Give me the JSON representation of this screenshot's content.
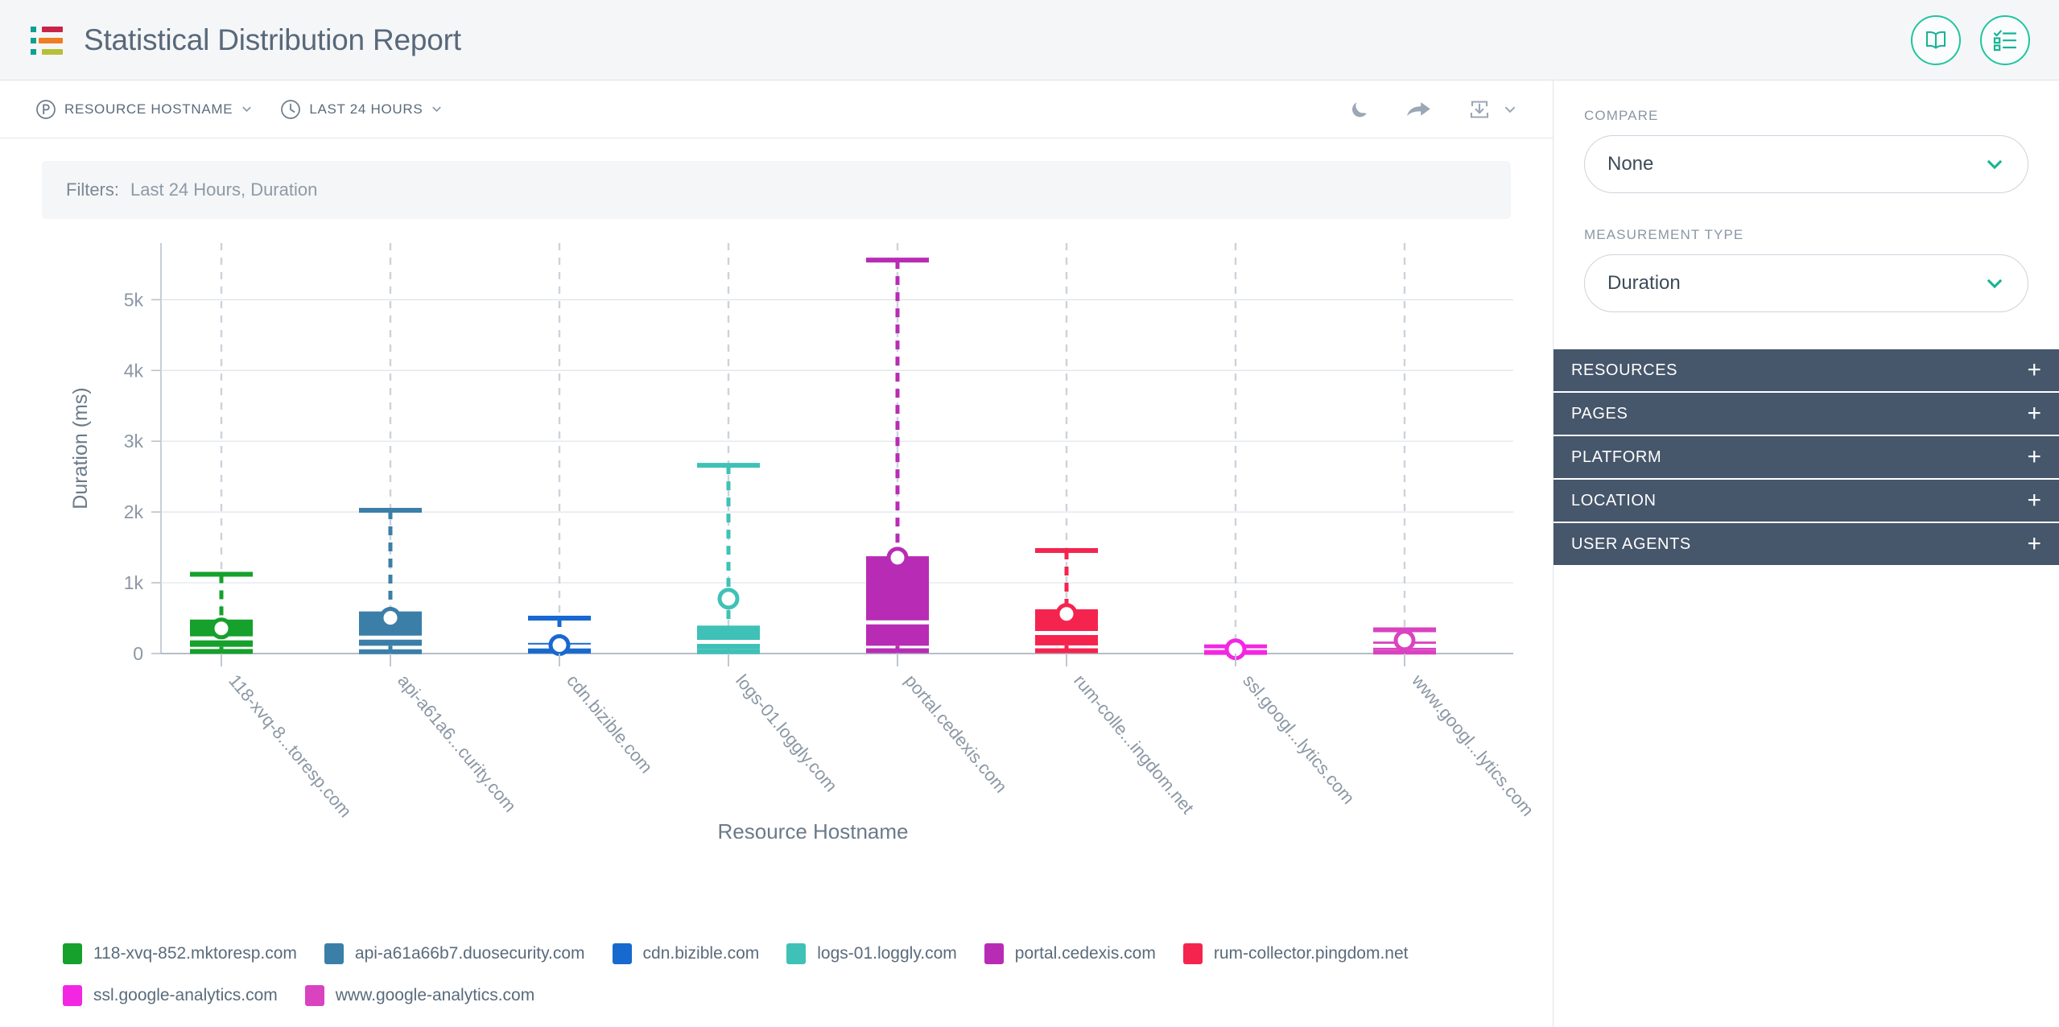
{
  "header": {
    "title": "Statistical Distribution Report",
    "logo_icon": "soasta-mpulse-logo",
    "actions": [
      {
        "name": "book-icon",
        "label": "Documentation"
      },
      {
        "name": "checklist-icon",
        "label": "Tasks"
      }
    ]
  },
  "toolbar": {
    "dimension_selector": {
      "label": "RESOURCE HOSTNAME",
      "icon": "p-circle-icon"
    },
    "time_selector": {
      "label": "LAST 24 HOURS",
      "icon": "clock-icon"
    },
    "right_actions": [
      {
        "name": "moon-icon",
        "label": "Dark Mode"
      },
      {
        "name": "share-arrow-icon",
        "label": "Share"
      },
      {
        "name": "download-icon",
        "label": "Download"
      }
    ]
  },
  "filters": {
    "label": "Filters:",
    "value": "Last 24 Hours,  Duration"
  },
  "chart_data": {
    "type": "box",
    "title": "",
    "xlabel": "Resource Hostname",
    "ylabel": "Duration (ms)",
    "ylim": [
      0,
      5800
    ],
    "yticks": [
      0,
      1000,
      2000,
      3000,
      4000,
      5000
    ],
    "ytick_labels": [
      "0",
      "1k",
      "2k",
      "3k",
      "4k",
      "5k"
    ],
    "grid": true,
    "legend_position": "bottom",
    "categories": [
      "118-xvq-8...toresp.com",
      "api-a61a6...curity.com",
      "cdn.bizible.com",
      "logs-01.loggly.com",
      "portal.cedexis.com",
      "rum-colle...ingdom.net",
      "ssl.googl...lytics.com",
      "www.googl...lytics.com"
    ],
    "boxes": [
      {
        "name": "118-xvq-852.mktoresp.com",
        "color": "#16a02c",
        "whisker_low": 30,
        "q1": 95,
        "median": 215,
        "q3": 480,
        "whisker_high": 1120,
        "mean": 355
      },
      {
        "name": "api-a61a66b7.duosecurity.com",
        "color": "#3b7fa8",
        "whisker_low": 25,
        "q1": 110,
        "median": 225,
        "q3": 595,
        "whisker_high": 2025,
        "mean": 505
      },
      {
        "name": "cdn.bizible.com",
        "color": "#1769cf",
        "whisker_low": 35,
        "q1": 60,
        "median": 100,
        "q3": 150,
        "whisker_high": 500,
        "mean": 120
      },
      {
        "name": "logs-01.loggly.com",
        "color": "#3fc1b7",
        "whisker_low": 25,
        "q1": 60,
        "median": 165,
        "q3": 395,
        "whisker_high": 2660,
        "mean": 775
      },
      {
        "name": "portal.cedexis.com",
        "color": "#b82cb5",
        "whisker_low": 40,
        "q1": 110,
        "median": 440,
        "q3": 1375,
        "whisker_high": 5560,
        "mean": 1355
      },
      {
        "name": "rum-collector.pingdom.net",
        "color": "#f4244f",
        "whisker_low": 40,
        "q1": 115,
        "median": 290,
        "q3": 625,
        "whisker_high": 1455,
        "mean": 560
      },
      {
        "name": "ssl.google-analytics.com",
        "color": "#f327e3",
        "whisker_low": 15,
        "q1": 30,
        "median": 45,
        "q3": 65,
        "whisker_high": 95,
        "mean": 60
      },
      {
        "name": "www.google-analytics.com",
        "color": "#d943c0",
        "whisker_low": 20,
        "q1": 55,
        "median": 110,
        "q3": 170,
        "whisker_high": 335,
        "mean": 185
      }
    ],
    "legend": [
      {
        "label": "118-xvq-852.mktoresp.com",
        "color": "#16a02c"
      },
      {
        "label": "api-a61a66b7.duosecurity.com",
        "color": "#3b7fa8"
      },
      {
        "label": "cdn.bizible.com",
        "color": "#1769cf"
      },
      {
        "label": "logs-01.loggly.com",
        "color": "#3fc1b7"
      },
      {
        "label": "portal.cedexis.com",
        "color": "#b82cb5"
      },
      {
        "label": "rum-collector.pingdom.net",
        "color": "#f4244f"
      },
      {
        "label": "ssl.google-analytics.com",
        "color": "#f327e3"
      },
      {
        "label": "www.google-analytics.com",
        "color": "#d943c0"
      }
    ]
  },
  "sidebar": {
    "compare": {
      "label": "COMPARE",
      "value": "None"
    },
    "measurement": {
      "label": "MEASUREMENT TYPE",
      "value": "Duration"
    },
    "sections": [
      {
        "title": "RESOURCES",
        "toggle": "+"
      },
      {
        "title": "PAGES",
        "toggle": "+"
      },
      {
        "title": "PLATFORM",
        "toggle": "+"
      },
      {
        "title": "LOCATION",
        "toggle": "+"
      },
      {
        "title": "USER AGENTS",
        "toggle": "+"
      }
    ]
  },
  "colors": {
    "accent": "#20c5a0",
    "panel_header": "#46566b",
    "text_muted": "#5a6b7c"
  }
}
